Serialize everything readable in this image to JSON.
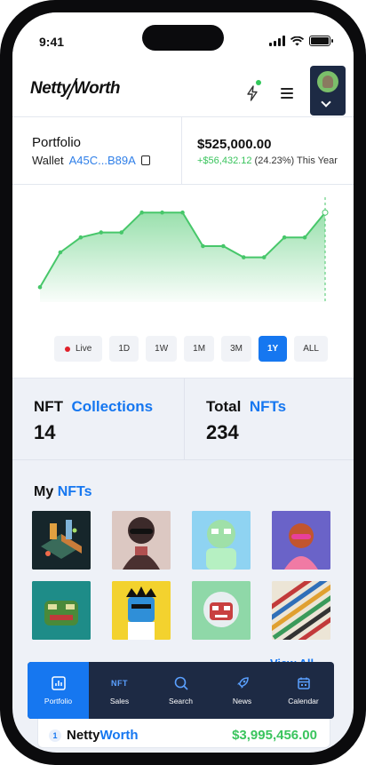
{
  "status_bar": {
    "time": "9:41"
  },
  "header": {
    "logo_part1": "Netty",
    "logo_part2": "Worth"
  },
  "portfolio": {
    "title": "Portfolio",
    "wallet_label": "Wallet",
    "wallet_address": "A45C...B89A",
    "value": "$525,000.00",
    "change": "+$56,432.12",
    "change_pct": "(24.23%)",
    "change_period": "This Year"
  },
  "chart_data": {
    "type": "area",
    "values": [
      12,
      40,
      52,
      56,
      56,
      72,
      72,
      72,
      45,
      45,
      36,
      36,
      52,
      52,
      72
    ],
    "ylim": [
      0,
      80
    ],
    "color": "#47c76a"
  },
  "ranges": {
    "live": "Live",
    "items": [
      "1D",
      "1W",
      "1M",
      "3M",
      "1Y",
      "ALL"
    ],
    "active": "1Y"
  },
  "stats": {
    "collections_label_a": "NFT",
    "collections_label_b": "Collections",
    "collections_value": "14",
    "total_label_a": "Total",
    "total_label_b": "NFTs",
    "total_value": "234"
  },
  "my_nfts": {
    "title_a": "My",
    "title_b": "NFTs",
    "view_all": "View All"
  },
  "bottom_card": {
    "rank": "1",
    "name_a": "Netty",
    "name_b": "Worth",
    "value": "$3,995,456.00"
  },
  "tabbar": {
    "items": [
      {
        "label": "Portfolio",
        "icon": "chart-icon"
      },
      {
        "label": "Sales",
        "icon": "nft-icon",
        "icon_text": "NFT"
      },
      {
        "label": "Search",
        "icon": "search-icon"
      },
      {
        "label": "News",
        "icon": "rocket-icon"
      },
      {
        "label": "Calendar",
        "icon": "calendar-icon"
      }
    ]
  },
  "colors": {
    "accent": "#1677f0",
    "positive": "#3ac45d",
    "navy": "#1d2a44"
  }
}
